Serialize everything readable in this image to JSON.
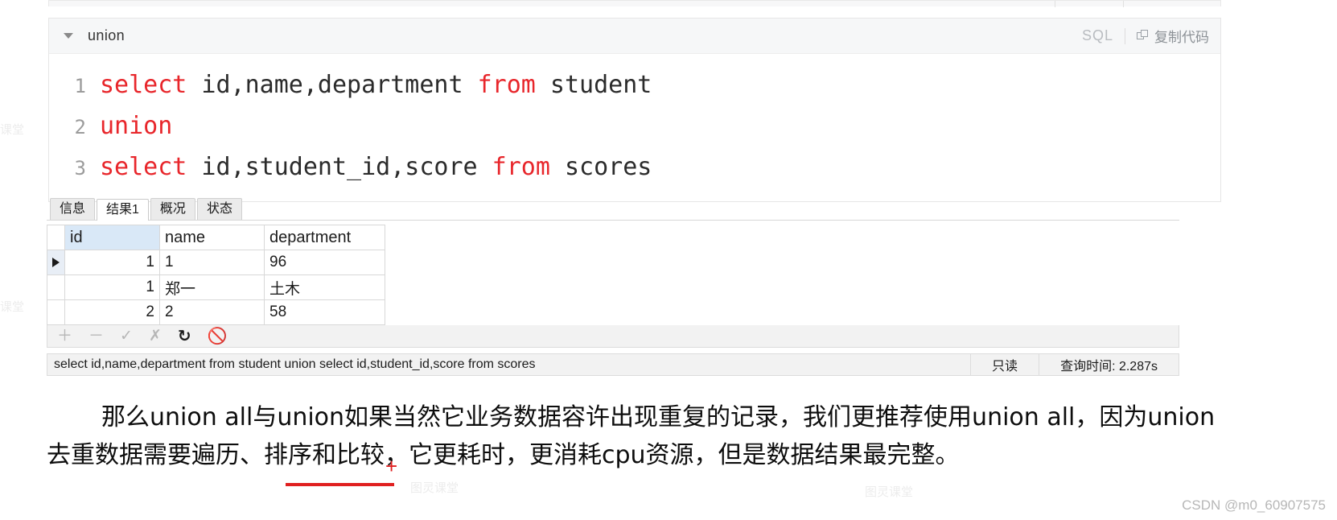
{
  "code_block": {
    "title": "union",
    "language_tag": "SQL",
    "copy_label": "复制代码",
    "lines": [
      {
        "num": "1",
        "tokens": [
          {
            "t": "select",
            "k": true
          },
          {
            "t": " id,name,department ",
            "k": false
          },
          {
            "t": "from",
            "k": true
          },
          {
            "t": " student",
            "k": false
          }
        ]
      },
      {
        "num": "2",
        "tokens": [
          {
            "t": "union",
            "k": true
          }
        ]
      },
      {
        "num": "3",
        "tokens": [
          {
            "t": "select",
            "k": true
          },
          {
            "t": " id,student_id,score ",
            "k": false
          },
          {
            "t": "from",
            "k": true
          },
          {
            "t": " scores",
            "k": false
          }
        ]
      }
    ],
    "keyword_color": "#e8262b",
    "text_color": "#2b2b2b"
  },
  "result_panel": {
    "tabs": [
      {
        "label": "信息",
        "active": false
      },
      {
        "label": "结果1",
        "active": true
      },
      {
        "label": "概况",
        "active": false
      },
      {
        "label": "状态",
        "active": false
      }
    ],
    "grid": {
      "columns": [
        "id",
        "name",
        "department"
      ],
      "selected_column": "id",
      "selected_column_color": "#d9e8f7",
      "rows": [
        {
          "marker": true,
          "id": "1",
          "name": "1",
          "department": "96"
        },
        {
          "marker": false,
          "id": "1",
          "name": "郑一",
          "department": "土木"
        },
        {
          "marker": false,
          "id": "2",
          "name": "2",
          "department": "58"
        }
      ]
    },
    "toolbar": [
      {
        "icon": "plus-icon",
        "glyph": "＋",
        "enabled": false
      },
      {
        "icon": "minus-icon",
        "glyph": "－",
        "enabled": false
      },
      {
        "icon": "check-icon",
        "glyph": "✓",
        "enabled": false
      },
      {
        "icon": "cross-icon",
        "glyph": "✗",
        "enabled": false
      },
      {
        "icon": "refresh-icon",
        "glyph": "↻",
        "enabled": true
      },
      {
        "icon": "stop-icon",
        "glyph": "🚫",
        "enabled": true
      }
    ],
    "status": {
      "sql": "select id,name,department from student union  select id,student_id,score from scores",
      "readonly": "只读",
      "query_time": "查询时间: 2.287s"
    }
  },
  "article": {
    "paragraph": "那么union all与union如果当然它业务数据容许出现重复的记录，我们更推荐使用union all，因为union去重数据需要遍历、排序和比较，它更耗时，更消耗cpu资源，但是数据结果最完整。",
    "watermark": "CSDN @m0_60907575"
  }
}
